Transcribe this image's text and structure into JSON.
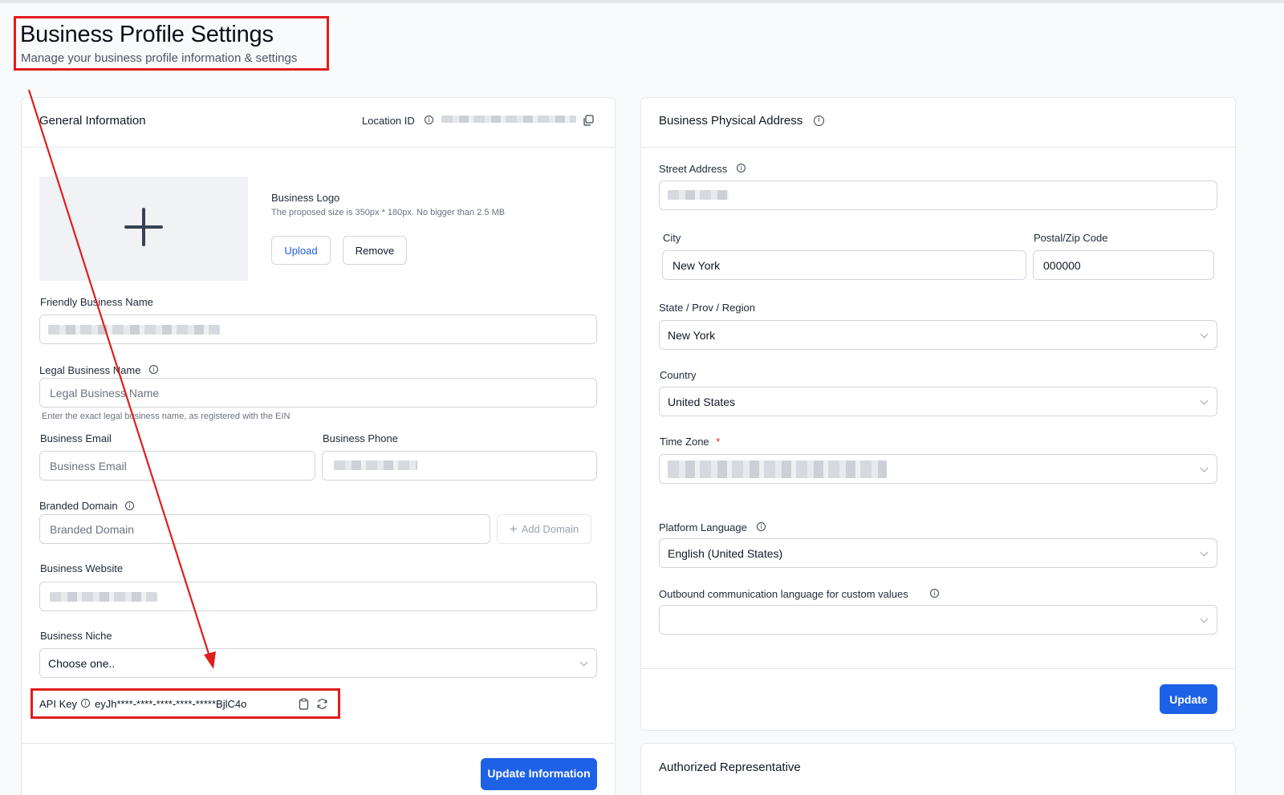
{
  "header": {
    "title": "Business Profile Settings",
    "subtitle": "Manage your business profile information & settings"
  },
  "general": {
    "title": "General Information",
    "location_label": "Location ID",
    "logo_label": "Business Logo",
    "logo_hint": "The proposed size is 350px * 180px. No bigger than 2.5 MB",
    "upload_label": "Upload",
    "remove_label": "Remove",
    "friendly_name_label": "Friendly Business Name",
    "legal_name_label": "Legal Business Name",
    "legal_name_placeholder": "Legal Business Name",
    "legal_name_hint": "Enter the exact legal business name, as registered with the EIN",
    "email_label": "Business Email",
    "email_placeholder": "Business Email",
    "phone_label": "Business Phone",
    "domain_label": "Branded Domain",
    "domain_placeholder": "Branded Domain",
    "add_domain_label": "Add Domain",
    "website_label": "Business Website",
    "niche_label": "Business Niche",
    "niche_value": "Choose one..",
    "api_label": "API Key",
    "api_value": "eyJh****-****-****-****-*****BjlC4o",
    "update_label": "Update Information"
  },
  "address": {
    "title": "Business Physical Address",
    "street_label": "Street Address",
    "city_label": "City",
    "city_value": "New York",
    "zip_label": "Postal/Zip Code",
    "zip_value": "000000",
    "state_label": "State / Prov / Region",
    "state_value": "New York",
    "country_label": "Country",
    "country_value": "United States",
    "timezone_label": "Time Zone",
    "timezone_required": "*",
    "language_label": "Platform Language",
    "language_value": "English (United States)",
    "outbound_label": "Outbound communication language for custom values",
    "outbound_value": "",
    "update_label": "Update"
  },
  "representative": {
    "title": "Authorized Representative"
  },
  "colors": {
    "primary": "#1d61e6",
    "annotation": "#e11d1d",
    "border": "#d1d5db"
  }
}
